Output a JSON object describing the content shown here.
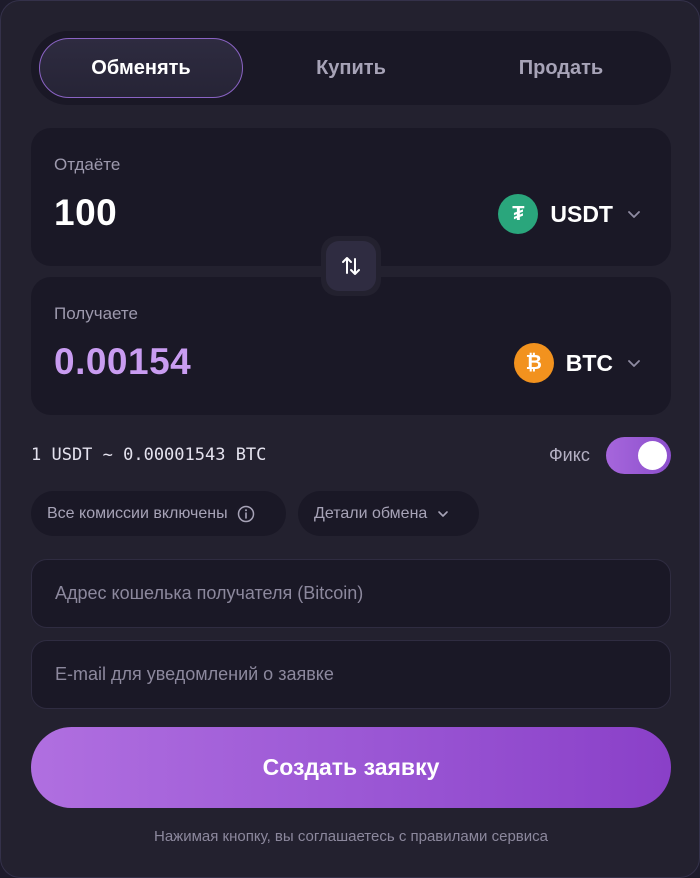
{
  "tabs": [
    {
      "label": "Обменять",
      "active": true
    },
    {
      "label": "Купить",
      "active": false
    },
    {
      "label": "Продать",
      "active": false
    }
  ],
  "give": {
    "label": "Отдаёте",
    "amount": "100",
    "currency": {
      "code": "USDT",
      "symbol": "₮",
      "icon": "tether-icon",
      "color": "#2aa67c"
    }
  },
  "get": {
    "label": "Получаете",
    "amount": "0.00154",
    "currency": {
      "code": "BTC",
      "symbol": "₿",
      "icon": "bitcoin-icon",
      "color": "#f2921e"
    }
  },
  "swap": {
    "icon": "swap-arrows-icon"
  },
  "rate": {
    "text": "1 USDT ~ 0.00001543 BTC"
  },
  "fix": {
    "label": "Фикс",
    "enabled": true
  },
  "chips": {
    "fees_label": "Все комиссии включены",
    "details_label": "Детали обмена"
  },
  "inputs": {
    "address_placeholder": "Адрес кошелька получателя (Bitcoin)",
    "email_placeholder": "E-mail для уведомлений о заявке"
  },
  "submit_label": "Создать заявку",
  "terms_text": "Нажимая кнопку, вы соглашаетесь с правилами сервиса",
  "colors": {
    "background": "#23212f",
    "panel": "#1a1826",
    "accent": "#9a56d4",
    "amount_highlight": "#c99cf1"
  }
}
